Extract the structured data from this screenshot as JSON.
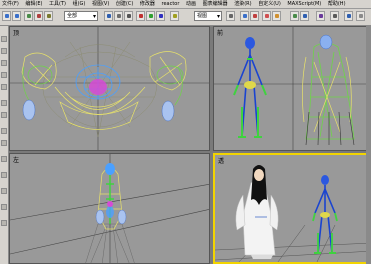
{
  "menubar": {
    "items": [
      "文件(F)",
      "编辑(E)",
      "工具(T)",
      "组(G)",
      "视图(V)",
      "创建(C)",
      "修改器",
      "reactor",
      "动画",
      "图表编辑器",
      "渲染(R)",
      "自定义(U)",
      "MAXScript(M)",
      "帮助(H)"
    ]
  },
  "toolbar": {
    "selection_filter": "全部",
    "coord_system": "视图"
  },
  "viewports": [
    {
      "label": "顶",
      "name": "top"
    },
    {
      "label": "前",
      "name": "front"
    },
    {
      "label": "左",
      "name": "left"
    },
    {
      "label": "透",
      "name": "perspective"
    }
  ],
  "colors": {
    "viewport_bg": "#999999",
    "active_border": "#f2d400",
    "wire_yellow": "#e8e26a",
    "wire_green": "#6fd34a",
    "wire_blue": "#4aa0ff",
    "wire_magenta": "#d64ad6"
  },
  "icons": [
    "undo-icon",
    "redo-icon",
    "link-icon",
    "unlink-icon",
    "bind-icon",
    "select-icon",
    "select-by-name-icon",
    "region-select-icon",
    "move-icon",
    "rotate-icon",
    "scale-icon",
    "mirror-icon",
    "align-icon",
    "render-icon",
    "teapot-icon"
  ]
}
